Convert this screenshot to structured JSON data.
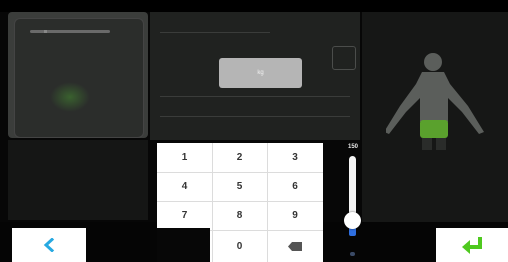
{
  "weight_display": {
    "unit_label": "kg"
  },
  "keypad": {
    "keys": [
      "1",
      "2",
      "3",
      "4",
      "5",
      "6",
      "7",
      "8",
      "9",
      "0"
    ],
    "backspace_icon": "backspace-icon"
  },
  "slider": {
    "max_label": "150",
    "level": 0.2
  },
  "navigation": {
    "back_icon": "chevron-left-icon",
    "confirm_icon": "enter-arrow-icon"
  },
  "colors": {
    "accent_blue": "#2f6fe0",
    "accent_green": "#4fc91f",
    "back_icon_color": "#27a9e1",
    "body_highlight": "#5aa12d"
  }
}
